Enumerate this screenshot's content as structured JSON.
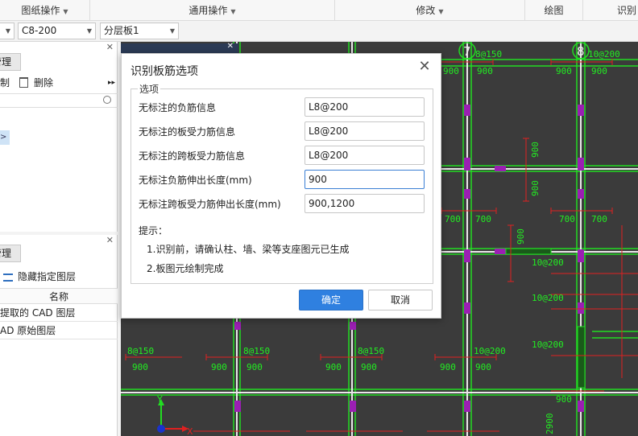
{
  "ribbon": {
    "groups": [
      {
        "label": "图纸操作"
      },
      {
        "label": "通用操作"
      },
      {
        "label": "修改"
      },
      {
        "label": "绘图"
      },
      {
        "label": "识别"
      }
    ]
  },
  "selectors": {
    "first_value": "",
    "rebar_value": "C8-200",
    "layer_value": "分层板1"
  },
  "panel1": {
    "tab_label": "管理",
    "draw_label": "制",
    "delete_label": "删除",
    "item_marker": ">"
  },
  "panel2": {
    "tab_label": "管理",
    "hide_layer_label": "隐藏指定图层",
    "column_header": "名称",
    "rows": [
      "提取的 CAD 图层",
      "AD 原始图层"
    ]
  },
  "dialog": {
    "title": "识别板筋选项",
    "group_legend": "选项",
    "fields": [
      {
        "label": "无标注的负筋信息",
        "value": "L8@200"
      },
      {
        "label": "无标注的板受力筋信息",
        "value": "L8@200"
      },
      {
        "label": "无标注的跨板受力筋信息",
        "value": "L8@200"
      },
      {
        "label": "无标注负筋伸出长度(mm)",
        "value": "900"
      },
      {
        "label": "无标注跨板受力筋伸出长度(mm)",
        "value": "900,1200"
      }
    ],
    "tips_title": "提示：",
    "tips": [
      "1.识别前，请确认柱、墙、梁等支座图元已生成",
      "2.板图元绘制完成"
    ],
    "ok_label": "确定",
    "cancel_label": "取消"
  },
  "cad": {
    "axis_labels": [
      "7",
      "8"
    ],
    "rebar_labels": [
      "8@150",
      "10@200",
      "8@150",
      "8@150",
      "8@150",
      "10@200",
      "10@200",
      "10@200",
      "10@200"
    ],
    "dims_900": "900",
    "dims_700": "700",
    "dim_2900": "2900",
    "ucs_y": "Y",
    "ucs_x": "X",
    "colors": {
      "bg": "#3b3b3b",
      "beam": "#22dd22",
      "rebar": "#e02020",
      "text": "#22ee22",
      "support": "#9b1fb3"
    }
  }
}
